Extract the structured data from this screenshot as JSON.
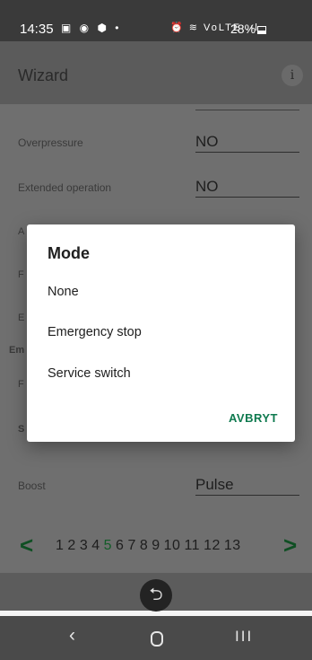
{
  "status_bar": {
    "time": "14:35",
    "left_icons": "▣ ◉ ⬢ •",
    "right_icons": "⏰ ≋ VoLTE .ıl",
    "battery": "28%"
  },
  "app_bar": {
    "title": "Wizard",
    "info_glyph": "i"
  },
  "form_rows": [
    {
      "label": "Overpressure",
      "value": "NO"
    },
    {
      "label": "Extended operation",
      "value": "NO"
    },
    {
      "label": "Boost",
      "value": "Pulse"
    }
  ],
  "partial_labels": [
    "A",
    "F",
    "E",
    "Em",
    "F",
    "S"
  ],
  "dialog": {
    "title": "Mode",
    "options": [
      "None",
      "Emergency stop",
      "Service switch"
    ],
    "cancel_label": "AVBRYT"
  },
  "pager": {
    "prev": "<",
    "next": ">",
    "pages": [
      "1",
      "2",
      "3",
      "4",
      "5",
      "6",
      "7",
      "8",
      "9",
      "10",
      "11",
      "12",
      "13"
    ],
    "active_index": 4
  },
  "bottom": {
    "back_glyph": "⮌"
  },
  "nav_bar": {
    "back": "‹",
    "recents": "III"
  },
  "colors": {
    "accent": "#0f7a4f",
    "pager_arrow": "#0f4f23",
    "active_page": "#125c28",
    "scrim": "#6f6f6f"
  }
}
